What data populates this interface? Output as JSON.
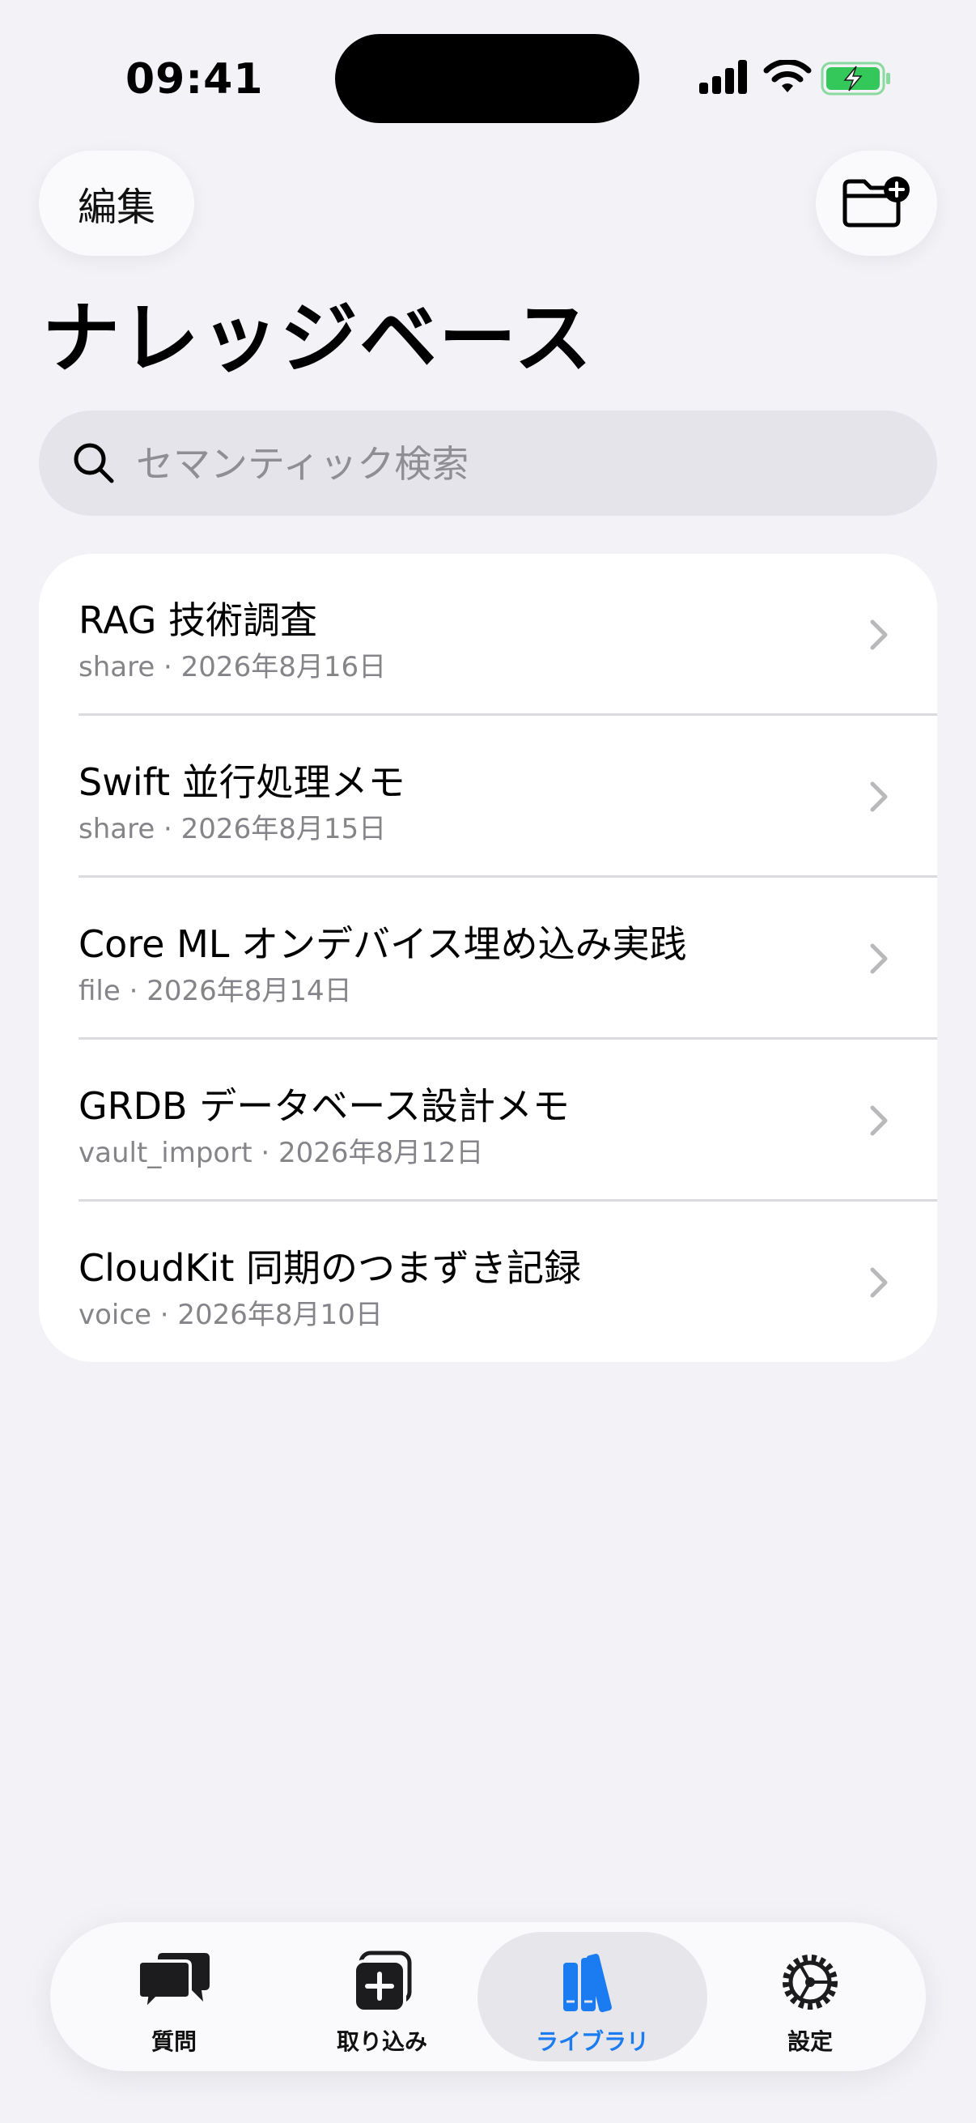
{
  "status_bar": {
    "time": "09:41"
  },
  "nav": {
    "edit_label": "編集",
    "new_folder_icon": "folder-plus-icon"
  },
  "page_title": "ナレッジベース",
  "search": {
    "placeholder": "セマンティック検索",
    "value": ""
  },
  "items": [
    {
      "title": "RAG 技術調査",
      "subtitle": "share · 2026年8月16日"
    },
    {
      "title": "Swift 並行処理メモ",
      "subtitle": "share · 2026年8月15日"
    },
    {
      "title": "Core ML オンデバイス埋め込み実践",
      "subtitle": "file · 2026年8月14日"
    },
    {
      "title": "GRDB データベース設計メモ",
      "subtitle": "vault_import · 2026年8月12日"
    },
    {
      "title": "CloudKit 同期のつまずき記録",
      "subtitle": "voice · 2026年8月10日"
    }
  ],
  "tabs": [
    {
      "label": "質問",
      "icon": "chat-bubbles-icon",
      "active": false
    },
    {
      "label": "取り込み",
      "icon": "add-square-icon",
      "active": false
    },
    {
      "label": "ライブラリ",
      "icon": "books-icon",
      "active": true
    },
    {
      "label": "設定",
      "icon": "gear-icon",
      "active": false
    }
  ],
  "colors": {
    "accent": "#1a7cf0",
    "background": "#f2f2f7",
    "battery": "#34c759"
  }
}
